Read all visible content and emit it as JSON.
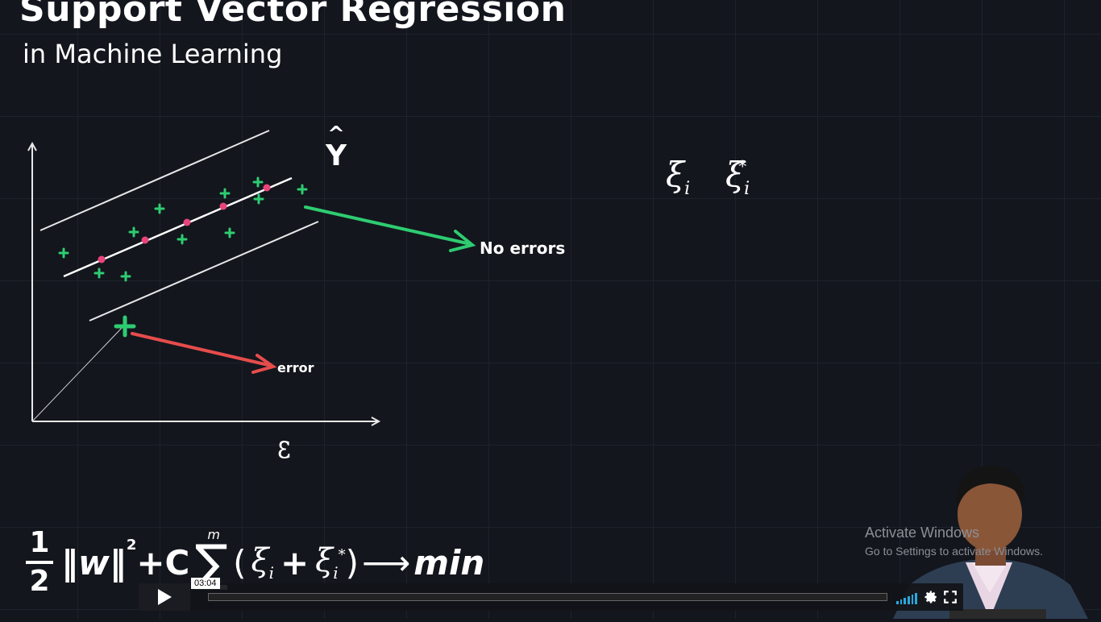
{
  "title": "Support Vector Regression",
  "subtitle": "in Machine Learning",
  "annotations": {
    "yhat": "Y",
    "yhat_caret": "^",
    "no_errors": "No errors",
    "error": "error",
    "epsilon_mark": "ε"
  },
  "slack": {
    "xi": "ξ",
    "sub": "i",
    "star": "*"
  },
  "formula": {
    "numerator": "1",
    "denominator": "2",
    "norm": "‖w‖",
    "squared": "2",
    "plus_c": "+C",
    "sigma": "∑",
    "sigma_top": "m",
    "open_paren": "(",
    "xi": "ξ",
    "sub": "i",
    "plus": "+",
    "star": "*",
    "close_paren": ")",
    "arrow": "⟶",
    "min": "min"
  },
  "watermark": {
    "line1": "Activate Windows",
    "line2": "Go to Settings to activate Windows."
  },
  "player": {
    "time": "03:04",
    "progress": 0.0,
    "icons": [
      "play-icon",
      "volume-icon",
      "gear-icon",
      "fullscreen-icon"
    ]
  },
  "colors": {
    "background": "#13161d",
    "point": "#2ecc71",
    "support_point": "#e8457a",
    "error_arrow": "#e74c4c",
    "ok_arrow": "#2ecc71",
    "volume": "#29a8e0"
  }
}
